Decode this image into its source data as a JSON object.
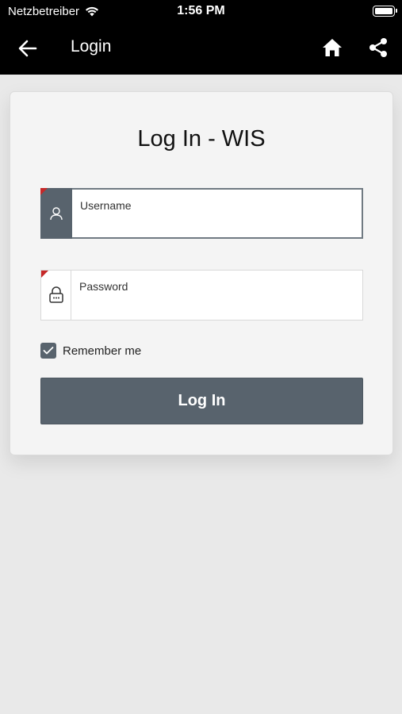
{
  "status_bar": {
    "carrier": "Netzbetreiber",
    "time": "1:56 PM"
  },
  "app_bar": {
    "title": "Login",
    "icons": [
      "back-arrow-icon",
      "home-icon",
      "share-icon"
    ]
  },
  "login_card": {
    "title": "Log In - WIS",
    "username": {
      "label": "Username",
      "value": "",
      "required": true
    },
    "password": {
      "label": "Password",
      "value": "",
      "required": true
    },
    "remember_me": {
      "label": "Remember me",
      "checked": true
    },
    "submit_label": "Log In"
  },
  "colors": {
    "app_bar_bg": "#000000",
    "accent": "#58636d",
    "required_marker": "#c62828",
    "page_bg": "#e9e9e9",
    "card_bg": "#f4f4f4"
  }
}
